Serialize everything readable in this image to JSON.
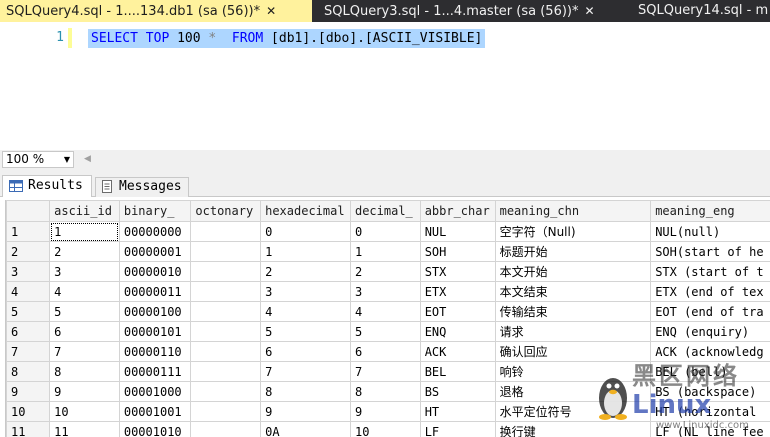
{
  "tabs": [
    {
      "label": "SQLQuery4.sql - 1....134.db1 (sa (56))*",
      "active": true
    },
    {
      "label": "SQLQuery3.sql - 1...4.master (sa (56))*",
      "active": false
    },
    {
      "label": "SQLQuery14.sql - m",
      "active": false
    }
  ],
  "tab_close_glyph": "✕",
  "editor": {
    "line_number": "1",
    "tokens": [
      "SELECT",
      "TOP",
      "100",
      "*",
      "FROM",
      "[db1].[dbo].[ASCII_VISIBLE]"
    ]
  },
  "zoom": {
    "value": "100 %"
  },
  "result_tabs": {
    "results": "Results",
    "messages": "Messages"
  },
  "grid": {
    "columns": [
      "ascii_id",
      "binary_",
      "octonary",
      "hexadecimal",
      "decimal_",
      "abbr_char",
      "meaning_chn",
      "meaning_eng"
    ],
    "rows": [
      [
        "1",
        "1",
        "00000000",
        "",
        "0",
        "0",
        "NUL",
        "空字符（Null)",
        "NUL(null)"
      ],
      [
        "2",
        "2",
        "00000001",
        "",
        "1",
        "1",
        "SOH",
        "标题开始",
        "SOH(start of he"
      ],
      [
        "3",
        "3",
        "00000010",
        "",
        "2",
        "2",
        "STX",
        "本文开始",
        "STX (start of t"
      ],
      [
        "4",
        "4",
        "00000011",
        "",
        "3",
        "3",
        "ETX",
        "本文结束",
        "ETX (end of tex"
      ],
      [
        "5",
        "5",
        "00000100",
        "",
        "4",
        "4",
        "EOT",
        "传输结束",
        "EOT (end of tra"
      ],
      [
        "6",
        "6",
        "00000101",
        "",
        "5",
        "5",
        "ENQ",
        "请求",
        "ENQ (enquiry)"
      ],
      [
        "7",
        "7",
        "00000110",
        "",
        "6",
        "6",
        "ACK",
        "确认回应",
        "ACK (acknowledg"
      ],
      [
        "8",
        "8",
        "00000111",
        "",
        "7",
        "7",
        "BEL",
        "响铃",
        "BEL (bell)"
      ],
      [
        "9",
        "9",
        "00001000",
        "",
        "8",
        "8",
        "BS",
        "退格",
        "BS (backspace)"
      ],
      [
        "10",
        "10",
        "00001001",
        "",
        "9",
        "9",
        "HT",
        "水平定位符号",
        "HT (horizontal"
      ],
      [
        "11",
        "11",
        "00001010",
        "",
        "0A",
        "10",
        "LF",
        "换行键",
        "LF (NL line fee"
      ]
    ]
  },
  "watermark": {
    "line1": "黑区网络",
    "line2": "Linux",
    "line3": "www.Linuxidc.com"
  },
  "colors": {
    "active_tab": "#fff29d",
    "selection": "#add6ff",
    "keyword": "#0000ff",
    "tabstrip": "#2d2d30"
  }
}
